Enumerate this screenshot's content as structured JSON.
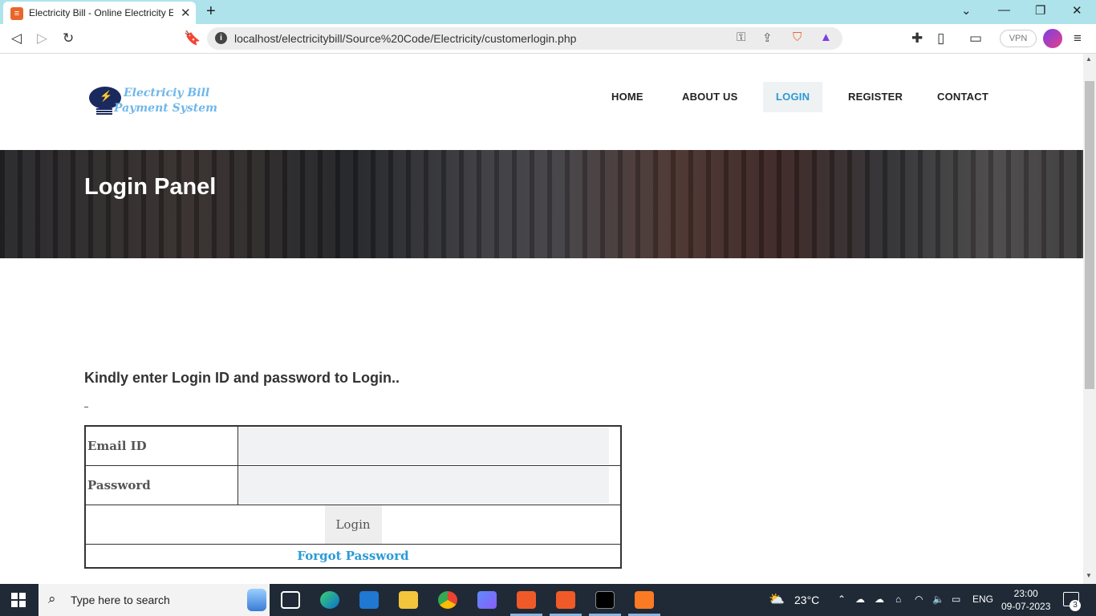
{
  "browser": {
    "tab_title": "Electricity Bill - Online Electricity E",
    "tab_favicon": "billing-icon",
    "url": "localhost/electricitybill/Source%20Code/Electricity/customerlogin.php",
    "vpn_label": "VPN"
  },
  "site": {
    "logo_line1": "Electriciy Bill",
    "logo_line2": "Payment System",
    "nav": [
      {
        "label": "HOME"
      },
      {
        "label": "ABOUT US"
      },
      {
        "label": "LOGIN",
        "active": true
      },
      {
        "label": "REGISTER"
      },
      {
        "label": "CONTACT"
      }
    ],
    "banner_title": "Login Panel"
  },
  "login": {
    "instruction": "Kindly enter Login ID and password to Login..",
    "email_label": "Email ID",
    "email_value": "",
    "password_label": "Password",
    "password_value": "",
    "login_button": "Login",
    "forgot_link": "Forgot Password"
  },
  "taskbar": {
    "search_placeholder": "Type here to search",
    "weather_temp": "23°C",
    "language": "ENG",
    "time": "23:00",
    "date": "09-07-2023",
    "notification_count": "3"
  },
  "colors": {
    "tabbar_bg": "#aee3ec",
    "accent_blue": "#2a9ad6",
    "logo_blue": "#6fb7ea",
    "taskbar_bg": "#1f2a36"
  }
}
